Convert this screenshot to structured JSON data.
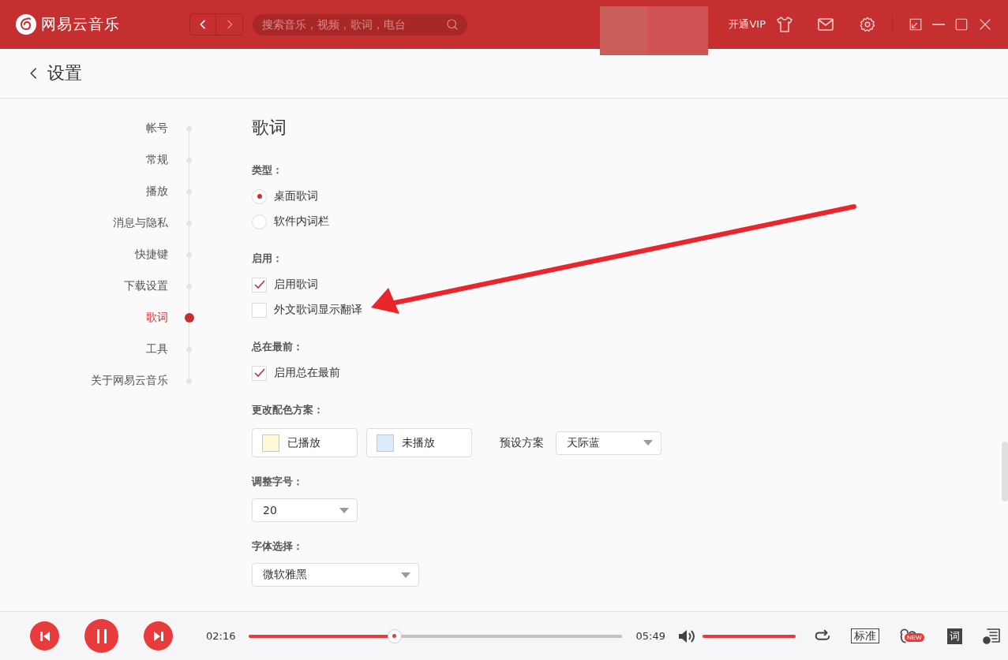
{
  "app": {
    "name": "网易云音乐",
    "search_placeholder": "搜索音乐，视频，歌词，电台",
    "vip": "开通VIP"
  },
  "page": {
    "title": "设置"
  },
  "nav": [
    {
      "label": "帐号",
      "selected": false
    },
    {
      "label": "常规",
      "selected": false
    },
    {
      "label": "播放",
      "selected": false
    },
    {
      "label": "消息与隐私",
      "selected": false
    },
    {
      "label": "快捷键",
      "selected": false
    },
    {
      "label": "下载设置",
      "selected": false
    },
    {
      "label": "歌词",
      "selected": true
    },
    {
      "label": "工具",
      "selected": false
    },
    {
      "label": "关于网易云音乐",
      "selected": false
    }
  ],
  "section": {
    "title": "歌词",
    "groups": [
      {
        "kind": "radio",
        "label": "类型：",
        "options": [
          {
            "label": "桌面歌词",
            "selected": true
          },
          {
            "label": "软件内词栏",
            "selected": false
          }
        ]
      },
      {
        "kind": "checkbox",
        "label": "启用：",
        "options": [
          {
            "label": "启用歌词",
            "checked": true
          },
          {
            "label": "外文歌词显示翻译",
            "checked": false
          }
        ]
      },
      {
        "kind": "checkbox",
        "label": "总在最前：",
        "options": [
          {
            "label": "启用总在最前",
            "checked": true
          }
        ]
      },
      {
        "kind": "colors",
        "label": "更改配色方案：",
        "swatches": [
          {
            "label": "已播放",
            "color": "#fff8d6"
          },
          {
            "label": "未播放",
            "color": "#dcebfb"
          }
        ],
        "preset_label": "预设方案",
        "preset": "天际蓝"
      },
      {
        "kind": "select",
        "label": "调整字号：",
        "value": "20",
        "wide": false
      },
      {
        "kind": "select",
        "label": "字体选择：",
        "value": "微软雅黑",
        "wide": true
      }
    ]
  },
  "player": {
    "elapsed": "02:16",
    "total": "05:49",
    "progress": {
      "level": 0.39
    },
    "volume": {
      "level": 1
    },
    "quality": "标准",
    "new_badge": "NEW",
    "lyrics_button": "词"
  }
}
